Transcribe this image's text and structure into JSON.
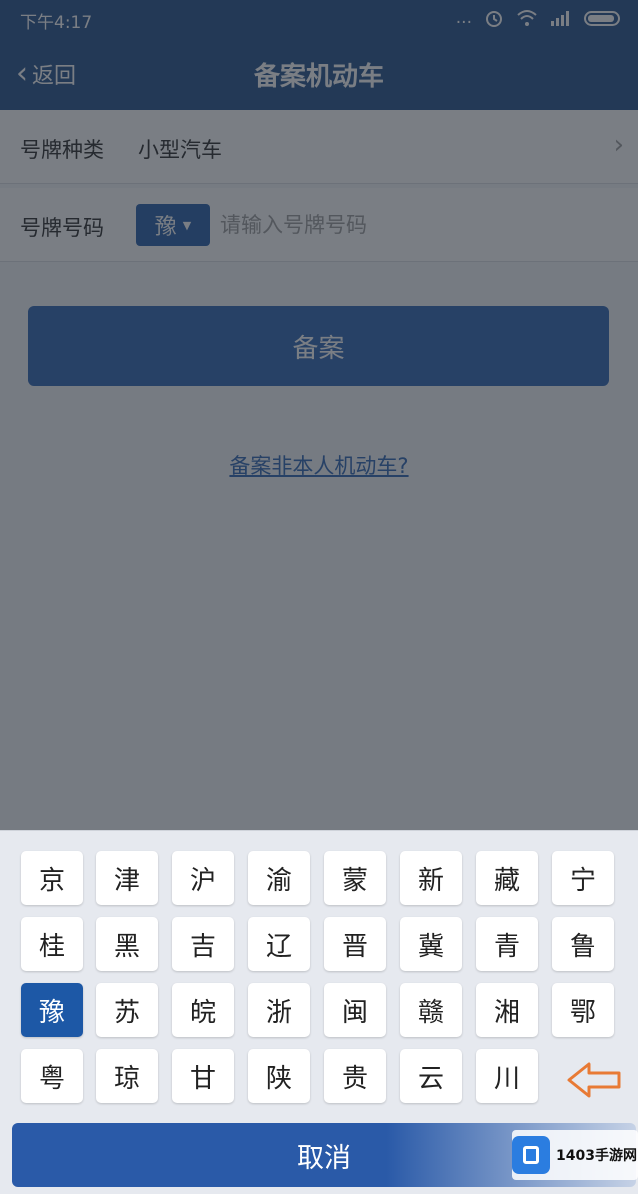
{
  "status_bar": {
    "time": "下午4:17",
    "dots": "..."
  },
  "header": {
    "back_label": "返回",
    "title": "备案机动车"
  },
  "form": {
    "plate_type_label": "号牌种类",
    "plate_type_value": "小型汽车",
    "plate_number_label": "号牌号码",
    "province_selected": "豫",
    "plate_number_placeholder": "请输入号牌号码",
    "submit_label": "备案",
    "other_link": "备案非本人机动车?"
  },
  "keyboard": {
    "rows": [
      [
        "京",
        "津",
        "沪",
        "渝",
        "蒙",
        "新",
        "藏",
        "宁"
      ],
      [
        "桂",
        "黑",
        "吉",
        "辽",
        "晋",
        "冀",
        "青",
        "鲁"
      ],
      [
        "豫",
        "苏",
        "皖",
        "浙",
        "闽",
        "赣",
        "湘",
        "鄂"
      ],
      [
        "粤",
        "琼",
        "甘",
        "陕",
        "贵",
        "云",
        "川"
      ]
    ],
    "active_key": "豫",
    "delete_icon": "backspace-arrow-icon",
    "cancel_label": "取消"
  },
  "watermark": {
    "text": "1403手游网"
  },
  "colors": {
    "primary": "#1b4a86",
    "accent": "#2660b0",
    "delete_arrow": "#e87a35"
  }
}
